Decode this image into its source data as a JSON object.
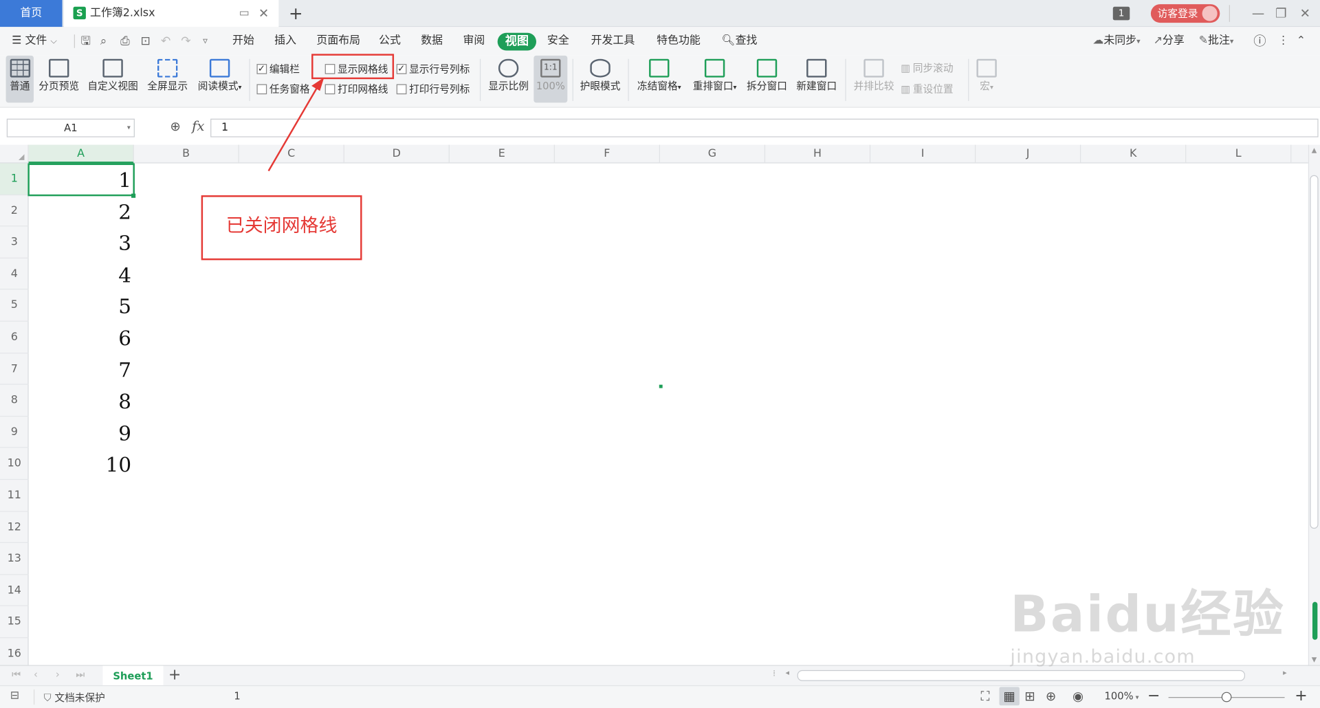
{
  "titlebar": {
    "home_tab": "首页",
    "doc_tab": "工作簿2.xlsx",
    "doc_logo": "S",
    "window_count": "1",
    "login_label": "访客登录",
    "add_tab": "+"
  },
  "menubar": {
    "file": "文件",
    "tabs": [
      "开始",
      "插入",
      "页面布局",
      "公式",
      "数据",
      "审阅",
      "视图",
      "安全",
      "开发工具",
      "特色功能"
    ],
    "active_tab": "视图",
    "search": "查找",
    "sync": "未同步",
    "share": "分享",
    "comment": "批注"
  },
  "ribbon": {
    "normal": "普通",
    "page_break_preview": "分页预览",
    "custom_view": "自定义视图",
    "full_screen": "全屏显示",
    "reading_mode": "阅读模式",
    "checkboxes": {
      "formula_bar": {
        "label": "编辑栏",
        "checked": true
      },
      "show_gridlines": {
        "label": "显示网格线",
        "checked": false
      },
      "show_headings": {
        "label": "显示行号列标",
        "checked": true
      },
      "task_pane": {
        "label": "任务窗格",
        "checked": false
      },
      "print_gridlines": {
        "label": "打印网格线",
        "checked": false
      },
      "print_headings": {
        "label": "打印行号列标",
        "checked": false
      }
    },
    "zoom": "显示比例",
    "zoom_100_icon": "1:1",
    "zoom_100": "100%",
    "eye_mode": "护眼模式",
    "freeze": "冻结窗格",
    "rearrange": "重排窗口",
    "split": "拆分窗口",
    "new_window": "新建窗口",
    "side_by_side": "并排比较",
    "sync_scroll": "同步滚动",
    "reset_position": "重设位置",
    "macro": "宏"
  },
  "formula_bar": {
    "name_box": "A1",
    "fx": "fx",
    "value": "1"
  },
  "grid": {
    "columns": [
      "A",
      "B",
      "C",
      "D",
      "E",
      "F",
      "G",
      "H",
      "I",
      "J",
      "K",
      "L"
    ],
    "rows": [
      "1",
      "2",
      "3",
      "4",
      "5",
      "6",
      "7",
      "8",
      "9",
      "10",
      "11",
      "12",
      "13",
      "14",
      "15",
      "16"
    ],
    "column_a_values": [
      "1",
      "2",
      "3",
      "4",
      "5",
      "6",
      "7",
      "8",
      "9",
      "10"
    ],
    "selected_cell": "A1"
  },
  "sheets": {
    "tabs": [
      "Sheet1"
    ],
    "add": "+"
  },
  "statusbar": {
    "protect": "文档未保护",
    "value": "1",
    "zoom": "100%"
  },
  "annotation": {
    "text": "已关闭网格线",
    "color": "#e53935"
  },
  "watermark": {
    "text": "Baidu经验",
    "url": "jingyan.baidu.com"
  },
  "colors": {
    "accent": "#1e9e58",
    "home_tab": "#3c7ad8",
    "login": "#e05b5b"
  }
}
